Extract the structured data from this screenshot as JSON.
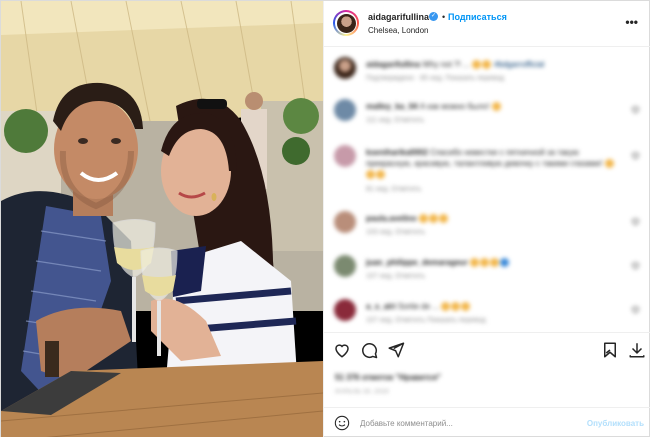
{
  "post": {
    "username": "aidagarifullina",
    "separator": "•",
    "follow_label": "Подписаться",
    "location": "Chelsea, London",
    "more": "•••"
  },
  "comments": [
    {
      "user": "aidagarifullina",
      "text": "Why not ?! ...",
      "hashtag": "#bdgarrofficial",
      "meta": "Подтверждено · 85 нед.   Показать перевод",
      "emoji": 2
    },
    {
      "user": "malley_ka_04",
      "text": "А как можно было!",
      "meta": "111 нед.   Ответить",
      "emoji": 1
    },
    {
      "user": "kseniharika0002",
      "text": "Спасибо невестке с пятничной за такую прекрасную, красивую, талантливую девочку с такими глазами!",
      "meta": "81 нед.   Ответить",
      "emoji": 3
    },
    {
      "user": "paula.avelino",
      "text": "",
      "meta": "103 нед.   Ответить",
      "emoji": 3
    },
    {
      "user": "juan_philippe_demarageur",
      "text": "",
      "meta": "107 нед.   Ответить",
      "emoji": 4
    },
    {
      "user": "a_s_alri",
      "text": "Sortie de ...",
      "meta": "107 нед.   Ответить   Показать перевод",
      "emoji": 3
    }
  ],
  "actions": {
    "likes": "51 376 отметок \"Нравится\"",
    "date": "АПРЕЛЬ 16, 2019"
  },
  "add_comment": {
    "placeholder": "Добавьте комментарий...",
    "publish_label": "Опубликовать"
  },
  "colors": {
    "accent": "#0095f6",
    "publish_disabled": "#b2dffc",
    "border": "#efefef",
    "muted": "#8e8e8e"
  },
  "icons": [
    "more-icon",
    "verified-icon",
    "heart-icon",
    "comment-icon",
    "share-icon",
    "bookmark-icon",
    "download-icon",
    "smile-icon"
  ]
}
